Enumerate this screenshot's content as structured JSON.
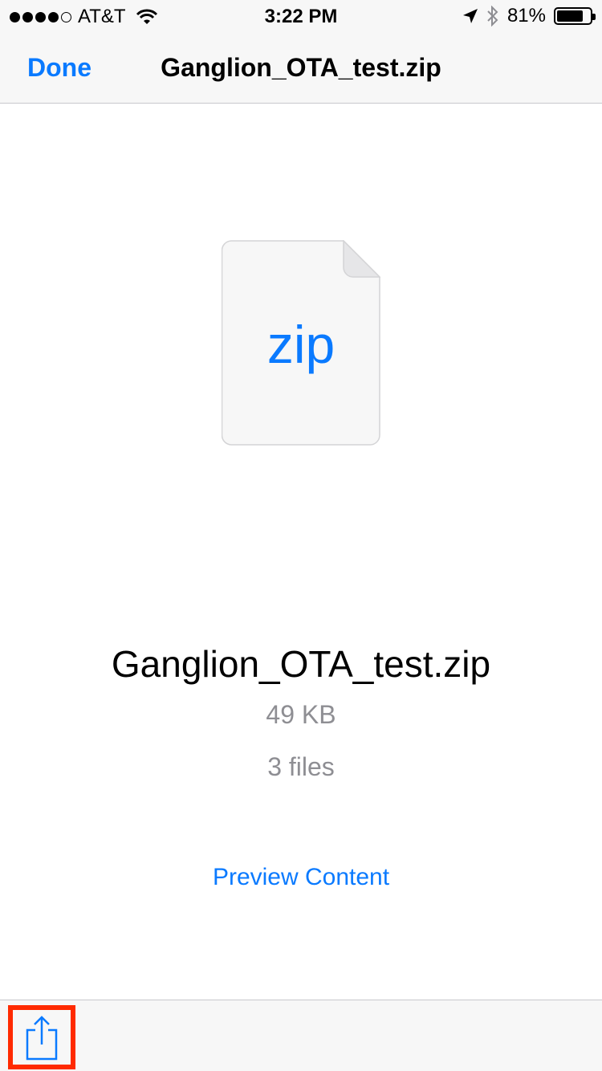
{
  "status": {
    "carrier": "AT&T",
    "time": "3:22 PM",
    "battery": "81%",
    "battery_level": 0.81,
    "signal_bars": 4,
    "signal_total": 5
  },
  "nav": {
    "done_label": "Done",
    "title": "Ganglion_OTA_test.zip"
  },
  "file": {
    "extension": "zip",
    "name": "Ganglion_OTA_test.zip",
    "size": "49 KB",
    "count": "3 files"
  },
  "actions": {
    "preview_label": "Preview Content"
  },
  "icons": {
    "wifi": "wifi-icon",
    "location": "location-arrow-icon",
    "bluetooth": "bluetooth-icon",
    "share": "share-icon"
  },
  "colors": {
    "accent": "#0a7aff",
    "secondary_text": "#8e8e93",
    "highlight": "#ff2a00"
  }
}
